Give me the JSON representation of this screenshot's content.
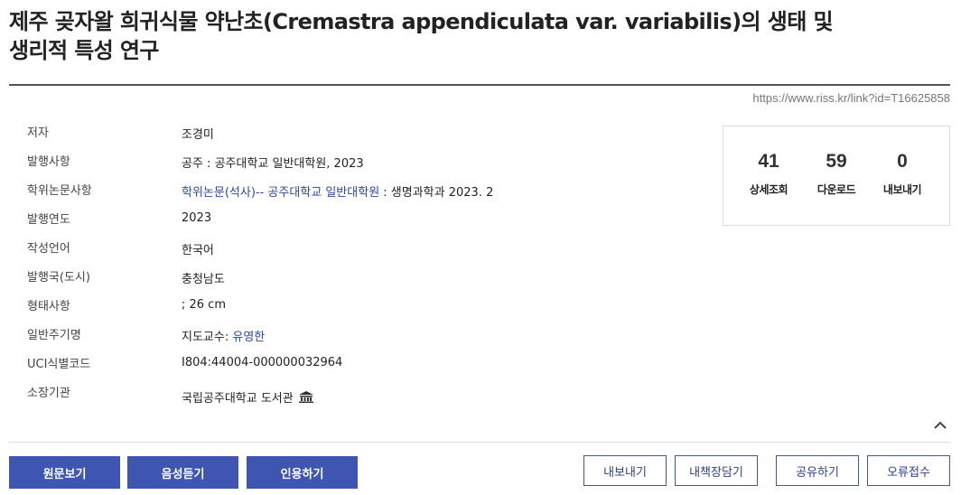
{
  "title": "제주 곶자왈 희귀식물 약난초(Cremastra appendiculata var. variabilis)의 생태 및 생리적 특성 연구",
  "link_url": "https://www.riss.kr/link?id=T16625858",
  "fields": {
    "author": {
      "label": "저자",
      "value": "조경미"
    },
    "publication": {
      "label": "발행사항",
      "value": "공주 : 공주대학교 일반대학원, 2023"
    },
    "thesis": {
      "label": "학위논문사항",
      "link": "학위논문(석사)-- 공주대학교 일반대학원",
      "rest": " : 생명과학과 2023. 2"
    },
    "year": {
      "label": "발행연도",
      "value": "2023"
    },
    "language": {
      "label": "작성언어",
      "value": "한국어"
    },
    "country": {
      "label": "발행국(도시)",
      "value": "충청남도"
    },
    "format": {
      "label": "형태사항",
      "value": "; 26 cm"
    },
    "note": {
      "label": "일반주기명",
      "prefix": "지도교수: ",
      "advisor": "유영한"
    },
    "uci": {
      "label": "UCI식별코드",
      "value": "I804:44004-000000032964"
    },
    "holding": {
      "label": "소장기관",
      "value": "국립공주대학교 도서관",
      "icon": "library-icon"
    }
  },
  "stats": [
    {
      "num": "41",
      "label": "상세조회"
    },
    {
      "num": "59",
      "label": "다운로드"
    },
    {
      "num": "0",
      "label": "내보내기"
    }
  ],
  "actions_primary": [
    "원문보기",
    "음성듣기",
    "인용하기"
  ],
  "actions_secondary": [
    "내보내기",
    "내책장담기",
    "공유하기",
    "오류접수"
  ],
  "colors": {
    "primary": "#3e55b2",
    "link": "#2b47a7"
  }
}
